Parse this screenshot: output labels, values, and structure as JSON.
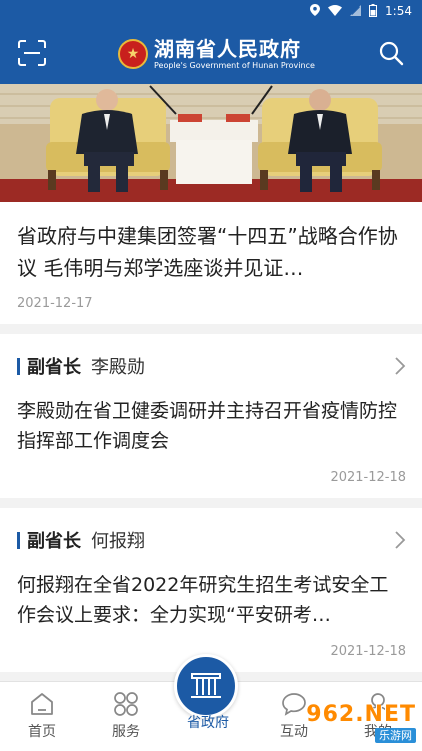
{
  "status": {
    "time": "1:54"
  },
  "header": {
    "title": "湖南省人民政府",
    "subtitle": "People's Government of Hunan Province",
    "brand_color": "#1c5aa5"
  },
  "feature": {
    "headline": "省政府与中建集团签署“十四五”战略合作协议 毛伟明与郑学选座谈并见证…",
    "date": "2021-12-17"
  },
  "cards": [
    {
      "role": "副省长",
      "name": "李殿勋",
      "title": "李殿勋在省卫健委调研并主持召开省疫情防控指挥部工作调度会",
      "date": "2021-12-18"
    },
    {
      "role": "副省长",
      "name": "何报翔",
      "title": "何报翔在全省2022年研究生招生考试安全工作会议上要求：全力实现“平安研考…",
      "date": "2021-12-18"
    }
  ],
  "tabs": {
    "home": "首页",
    "service": "服务",
    "center": "省政府",
    "hudong": "互动",
    "mine": "我的"
  },
  "watermark": {
    "main": "962.NET",
    "sub": "乐游网"
  }
}
